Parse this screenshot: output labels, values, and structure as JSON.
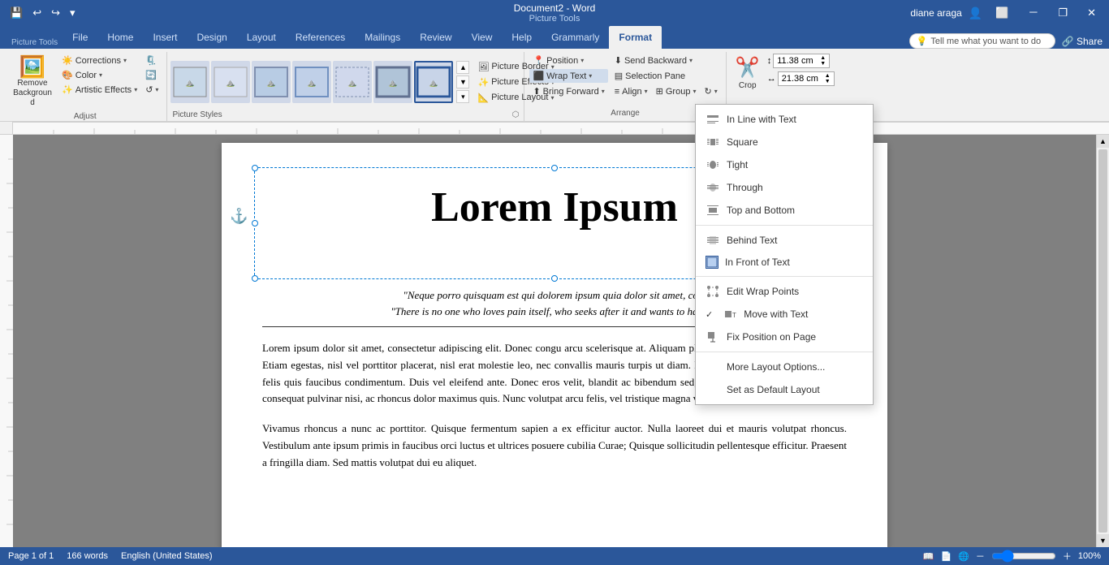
{
  "titlebar": {
    "quickaccess": [
      "save",
      "undo",
      "redo",
      "customize"
    ],
    "doc_title": "Document2 - Word",
    "picture_tools": "Picture Tools",
    "user": "diane araga",
    "win_btns": [
      "minimize",
      "restore",
      "close"
    ]
  },
  "tabs": {
    "app_tabs": [
      "File",
      "Home",
      "Insert",
      "Design",
      "Layout",
      "References",
      "Mailings",
      "Review",
      "View",
      "Help",
      "Grammarly"
    ],
    "active": "Format",
    "context_tab": "Format",
    "context_group": "Picture Tools"
  },
  "ribbon": {
    "adjust_group": {
      "label": "Adjust",
      "remove_background": "Remove Background",
      "corrections": "Corrections",
      "color": "Color",
      "artistic_effects": "Artistic Effects",
      "compress": "Compress\nPictures",
      "change": "Change\nPicture",
      "reset": "Reset\nPicture"
    },
    "picture_styles": {
      "label": "Picture Styles",
      "thumbs": [
        "style1",
        "style2",
        "style3",
        "style4",
        "style5",
        "style6",
        "style7"
      ],
      "border_btn": "Picture Border",
      "effects_btn": "Picture Effects",
      "layout_btn": "Picture Layout"
    },
    "arrange": {
      "label": "Arrange",
      "position": "Position",
      "wrap_text": "Wrap Text",
      "bring_forward": "Bring Forward",
      "send_backward": "Send Backward",
      "selection_pane": "Selection Pane",
      "align": "Align",
      "group": "Group",
      "rotate": "Rotate"
    },
    "size": {
      "label": "Size",
      "height": "11.38 cm",
      "width": "21.38 cm",
      "crop": "Crop"
    }
  },
  "wrap_menu": {
    "items": [
      {
        "id": "inline",
        "label": "In Line with Text",
        "checked": false
      },
      {
        "id": "square",
        "label": "Square",
        "checked": false
      },
      {
        "id": "tight",
        "label": "Tight",
        "checked": false
      },
      {
        "id": "through",
        "label": "Through",
        "checked": false
      },
      {
        "id": "topbottom",
        "label": "Top and Bottom",
        "checked": false
      },
      {
        "id": "behind",
        "label": "Behind Text",
        "checked": false
      },
      {
        "id": "infront",
        "label": "In Front of Text",
        "checked": false
      },
      {
        "separator": true
      },
      {
        "id": "editwrap",
        "label": "Edit Wrap Points",
        "checked": false
      },
      {
        "id": "movewith",
        "label": "Move with Text",
        "checked": true
      },
      {
        "id": "fixpos",
        "label": "Fix Position on Page",
        "checked": false
      },
      {
        "separator": true
      },
      {
        "id": "moreoptions",
        "label": "More Layout Options...",
        "checked": false
      },
      {
        "id": "setdefault",
        "label": "Set as Default Layout",
        "checked": false
      }
    ]
  },
  "document": {
    "title": "Lorem Ipsum",
    "quote1": "\"Neque porro quisquam est qui dolorem ipsum quia dolor sit amet, co...",
    "quote2": "\"There is no one who loves pain itself, who seeks after it and wants to have it,",
    "body1": "Lorem ipsum dolor sit amet, consectetur adipiscing elit. Donec congu arcu scelerisque at. Aliquam placerat metus sed pulvinar volutpat. Etiam egestas, nisl vel porttitor placerat, nisl erat molestie leo, nec convallis mauris turpis ut diam. Duis in sagittis ex. Duis malesuada felis quis faucibus condimentum. Duis vel eleifend ante. Donec eros velit, blandit ac bibendum sed, sagittis eleifend nisl. Pellentesque consequat pulvinar nisi, ac rhoncus dolor maximus quis. Nunc volutpat arcu felis, vel tristique magna vehicula eget.",
    "body2": "Vivamus rhoncus a nunc ac porttitor. Quisque fermentum sapien a ex efficitur auctor. Nulla laoreet dui et mauris volutpat rhoncus. Vestibulum ante ipsum primis in faucibus orci luctus et ultrices posuere cubilia Curae; Quisque sollicitudin pellentesque efficitur. Praesent a fringilla diam. Sed mattis volutpat dui eu aliquet."
  },
  "statusbar": {
    "page": "Page 1 of 1",
    "words": "166 words",
    "lang": "English (United States)"
  },
  "tell_me": {
    "placeholder": "Tell me what you want to do"
  }
}
